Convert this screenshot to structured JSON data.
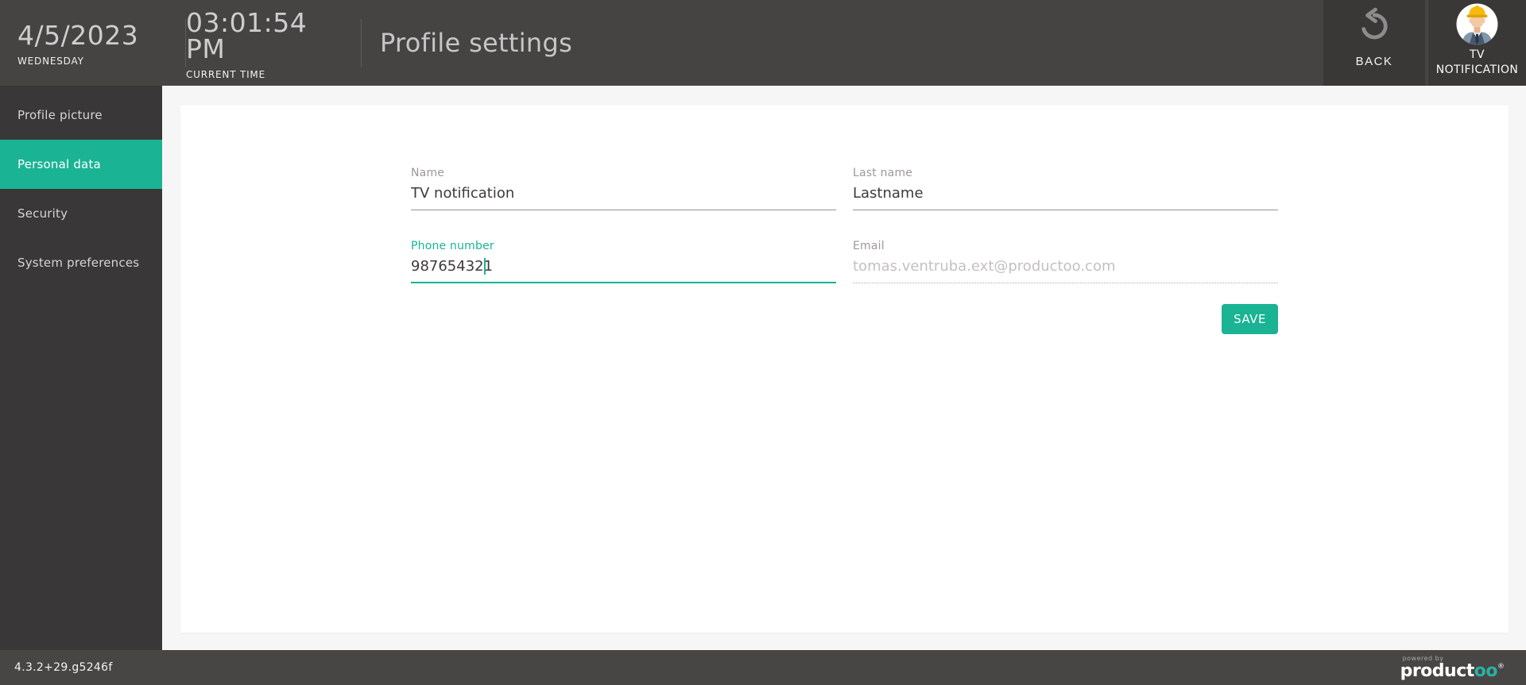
{
  "header": {
    "date": "4/5/2023",
    "date_sub": "WEDNESDAY",
    "time": "03:01:54 PM",
    "time_sub": "CURRENT TIME",
    "title": "Profile settings",
    "back_label": "BACK",
    "user_line1": "TV",
    "user_line2": "NOTIFICATION"
  },
  "sidebar": {
    "items": [
      {
        "label": "Profile picture",
        "active": false
      },
      {
        "label": "Personal data",
        "active": true
      },
      {
        "label": "Security",
        "active": false
      },
      {
        "label": "System preferences",
        "active": false
      }
    ]
  },
  "form": {
    "name": {
      "label": "Name",
      "value": "TV notification"
    },
    "last_name": {
      "label": "Last name",
      "value": "Lastname"
    },
    "phone": {
      "label": "Phone number",
      "value": "987654321"
    },
    "email": {
      "label": "Email",
      "value": "tomas.ventruba.ext@productoo.com"
    },
    "save_label": "SAVE"
  },
  "footer": {
    "version": "4.3.2+29.g5246f",
    "powered_by": "powered by",
    "brand": "product",
    "brand_suffix": "oo",
    "registered": "®"
  },
  "icons": {
    "back": "undo-arrow-icon",
    "user": "construction-worker-avatar"
  },
  "colors": {
    "accent": "#1ab394",
    "header_bg": "#464343",
    "panel_bg": "#3a3737",
    "sidebar_bg": "#393737",
    "footer_bg": "#484545",
    "main_bg": "#f6f6f6",
    "card_bg": "#ffffff",
    "label_gray": "#9b9998",
    "value_dark": "#3d3b3a",
    "email_text": "#c3c1c0"
  }
}
